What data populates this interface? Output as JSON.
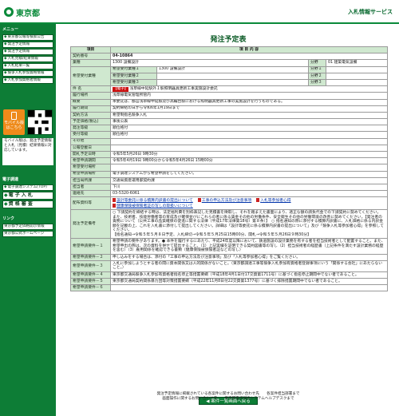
{
  "header": {
    "logo_text": "東京都",
    "service": "入札情報サービス"
  },
  "sidebar": {
    "menu_label": "メニュー",
    "links": [
      "東京都公報等検索公告",
      "発注予定情報",
      "発注予定情報",
      "入札見積/結果情報",
      "入札結果一覧",
      "競争入札参加資格情報",
      "入札参加資格者情報"
    ],
    "mobile_label": "モバイル版",
    "mobile_sub": "はこちら",
    "note": "モバイル版は、発注予定情報と入札（見積）結果情報に対応しています。",
    "links2_label": "電子調達",
    "links2": [
      "電子調達システム(TOP)",
      "電 子 入 札",
      "資 格 審 査"
    ],
    "ext_label": "リンク",
    "ext": [
      "東京都予定価格開示情報",
      "東京都公式ホームページ"
    ]
  },
  "main": {
    "title": "発注予定表",
    "col_item": "項目",
    "col_content": "項 目 内 容",
    "rows": {
      "contract_no_label": "契約番号",
      "contract_no": "04-10864",
      "business_label": "業種",
      "business": "1300 設備設計",
      "bunya_label": "分野",
      "bunya": "01 建築電気設備",
      "wish_label": "希望受付業種",
      "wish1_label": "希望受付業種１",
      "wish1": "1300 設備設計",
      "wish1_field": "1300 設備設計",
      "bunya1_label": "分野１",
      "wish2_label": "希望受付業種２",
      "bunya2_label": "分野２",
      "wish3_label": "希望受付業種３",
      "bunya3_label": "分野３",
      "subject_label": "件 名",
      "subject_tag": "【電子】",
      "subject": "浅草線中延駅外１駅照明器具更新工事実施設計委託",
      "location_label": "履行場所",
      "location": "浅草線電気管理所管内",
      "outline_label": "概要",
      "outline": "本委託は、都営浅草線中延駅及び高輪台駅における照明器具更新工事の実施設計を行うものである。",
      "period_label": "履行期間",
      "period": "契約締結の日から令和6年1月19日まで",
      "method_label": "契約方法",
      "method": "希望制指名競争入札",
      "price_label": "予定価格(税込)",
      "price": "事後公表",
      "section_label": "発注等級",
      "section": "順位格付",
      "accept_label": "受付等級",
      "accept": "順位格付",
      "other_label": "その他",
      "other": "",
      "pubdate_label": "公報登載日",
      "pubdate": "",
      "open_label": "開札予定日時",
      "open": "令和5年5月26日 9時30分",
      "accept_period_label": "希望申請期間",
      "accept_period": "令和5年4月19日 9時00分から令和5年4月26日 15時00分",
      "contact_label": "希望受付場所",
      "contact": "",
      "wish_place_label": "希望申請場所",
      "wish_place": "電子調達システムから希望申請をしてください。",
      "dept_label": "担当局所課",
      "dept": "交通局資産運用部契約課",
      "person_label": "担当者",
      "person": "下川",
      "tel_label": "連絡先",
      "tel": "03-5320-6061",
      "attach_label": "配布資料等",
      "attachments": [
        "設計等委託に係る積算内訳書の提出について",
        "工事の申込方法及び注意事項",
        "入札等参加者心得",
        "健康保険被保険者証の写しの取扱いについて"
      ],
      "cond_label": "発注予定備考",
      "cond": "○ 下請契約を締結する時は、法定福利費を別枠表記した見積書を徴取し、それを踏まえた書面により、適正な額の請負代金での下請契約に努めてください。　また、技術者、技能労働者等の育成及び確保並びにこれらの者に係る賃金その他の労働条件、安全衛生その他の労働環境の改善に努めてください。【発注者の責務について（公共工事の品質確保の促進に関する法律（平成17年法律第18号）第８条）】　○ 指名通知の際に添付する積算内訳書に、入札価格に係る内訳金額を記載の上、これを入札書に添付して提出してください。詳細は「設計等委託に係る積算内訳書の提出について」及び「競争入札等参加者心得」を参照してください。",
      "cond_tail": "【指名通知→令和５年５月８日予定、入札締切→令和５年５月25日15時00分、開札→令和５年５月26日９時30分】",
      "req1_label": "希望申請要件－１",
      "req1": "希望申請の要件があります。● 本件を履行するにあたり、平成24年度以降において、鉄道施設の設計業務を有する者を担当技術者として配置すること。また、希望申出の際は、次の資料を併せて提出すること。（1）上記実績を証明できる契約図書等の写し（2）担当技術者の経歴書（上記条件を満たす設計業務の経歴を含む）（3）雇用関係を確認できる書類（健康保険被保険者証などの写し）",
      "req2_label": "希望申請要件－２",
      "req2": "申し込みをする場合は、添付の「工事の申込方法及び注意事項」及び「入札等参加者心得」をご覧ください。",
      "req3_label": "希望申請要件－３",
      "req3": "入札に参加しようとする者の間に資本関係又は人的関係がないこと。（東京都調達工事等競争入札参加有資格者登録事項にいう「関係する会社」にあたらないこと。）",
      "req4_label": "希望申請要件－４",
      "req4": "東京都交通局競争入札参加有資格者指名停止等措置要綱（平成18年4月1日付17交資第1711号）に基づく指名停止期間中でない者であること。",
      "req5_label": "希望申請要件－５",
      "req5": "東京都交通局契約関係暴力団等対策措置要綱（平成22年11月8日付22交資第1377号）に基づく排除措置期間中でない者であること。",
      "req6_label": "希望申請要件－６",
      "req6": ""
    },
    "back_button": "案件一覧画面へ戻る"
  },
  "footer": {
    "line1": "発注予定情報に掲載されている各案件に関するお問い合わせ先　　各案件担当部署まで",
    "line2": "画面操作に関するお問い合わせ先　　東京都電子調達システムヘルプデスクまで"
  },
  "colors": {
    "brand_green": "#0d7d36",
    "label_bg": "#cfe8cf",
    "tag_red": "#cc1111"
  }
}
